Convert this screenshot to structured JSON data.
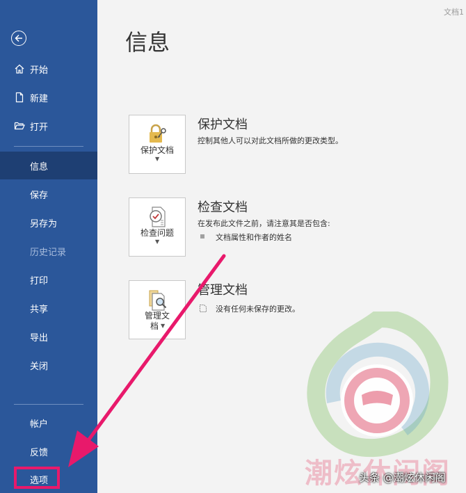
{
  "window": {
    "doc_title": "文档1"
  },
  "sidebar": {
    "items": [
      {
        "label": "开始"
      },
      {
        "label": "新建"
      },
      {
        "label": "打开"
      },
      {
        "label": "信息"
      },
      {
        "label": "保存"
      },
      {
        "label": "另存为"
      },
      {
        "label": "历史记录"
      },
      {
        "label": "打印"
      },
      {
        "label": "共享"
      },
      {
        "label": "导出"
      },
      {
        "label": "关闭"
      },
      {
        "label": "帐户"
      },
      {
        "label": "反馈"
      },
      {
        "label": "选项"
      }
    ]
  },
  "main": {
    "title": "信息",
    "sections": [
      {
        "button_label": "保护文档",
        "title": "保护文档",
        "desc": "控制其他人可以对此文档所做的更改类型。"
      },
      {
        "button_label": "检查问题",
        "title": "检查文档",
        "desc": "在发布此文件之前，请注意其是否包含:",
        "bullet": "文档属性和作者的姓名"
      },
      {
        "button_label_1": "管理文",
        "button_label_2": "档",
        "title": "管理文档",
        "desc": "没有任何未保存的更改。"
      }
    ]
  },
  "watermark": {
    "text": "潮炫休闲阁",
    "source": "头条 @潮炫休闲阁"
  },
  "colors": {
    "sidebar": "#2b579a",
    "sidebar_active": "#1e3f73",
    "highlight": "#e8196b"
  }
}
